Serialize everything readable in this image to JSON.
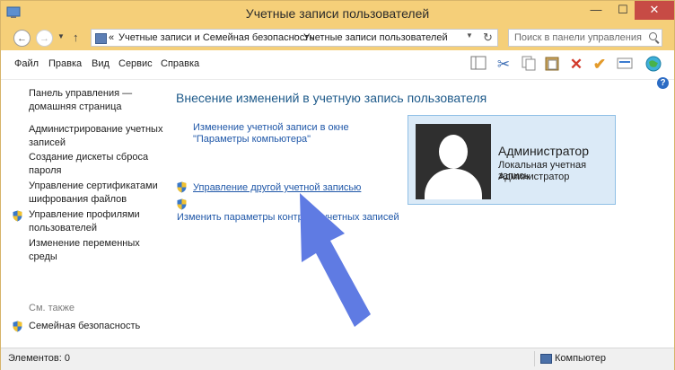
{
  "window": {
    "title": "Учетные записи пользователей",
    "close_glyph": "✕",
    "min_glyph": "—",
    "max_glyph": "☐"
  },
  "address": {
    "prefix": "«",
    "crumbs": [
      "Учетные записи и Семейная безопасность",
      "Учетные записи пользователей"
    ],
    "search_placeholder": "Поиск в панели управления"
  },
  "menu": [
    "Файл",
    "Правка",
    "Вид",
    "Сервис",
    "Справка"
  ],
  "toolbar_icons": [
    "layout-icon",
    "cut-icon",
    "copy-icon",
    "paste-icon",
    "delete-icon",
    "checkmark-icon",
    "mail-icon",
    "globe-icon"
  ],
  "sidebar": {
    "links": [
      "Панель управления — домашняя страница",
      "Администрирование учетных записей",
      "Создание дискеты сброса пароля",
      "Управление сертификатами шифрования файлов",
      "Управление профилями пользователей",
      "Изменение переменных среды"
    ],
    "see_also_label": "См. также",
    "see_also_link": "Семейная безопасность"
  },
  "main": {
    "heading": "Внесение изменений в учетную запись пользователя",
    "link_settings": "Изменение учетной записи в окне \"Параметры компьютера\"",
    "link_manage_other": "Управление другой учетной записью",
    "link_uac": "Изменить параметры контроля учетных записей"
  },
  "user_card": {
    "name": "Администратор",
    "type": "Локальная учетная запись",
    "role": "Администратор"
  },
  "status": {
    "items": "Элементов: 0",
    "location": "Компьютер"
  },
  "colors": {
    "titlebar": "#f5cf79",
    "link": "#1f57a8",
    "heading": "#1e5a8a",
    "arrow": "#5f7be3"
  }
}
